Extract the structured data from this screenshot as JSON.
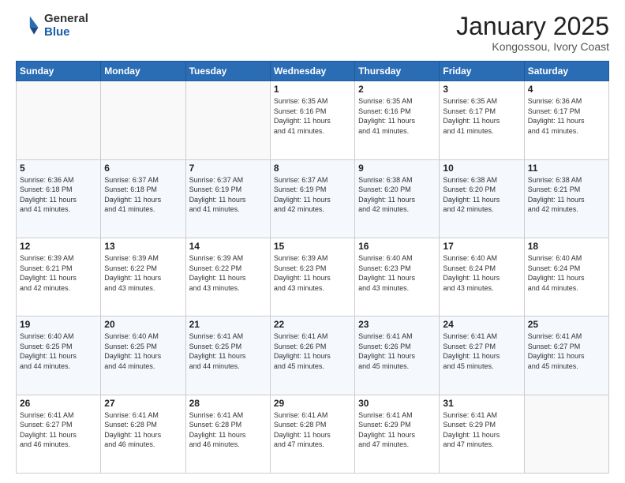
{
  "header": {
    "logo_general": "General",
    "logo_blue": "Blue",
    "title": "January 2025",
    "location": "Kongossou, Ivory Coast"
  },
  "weekdays": [
    "Sunday",
    "Monday",
    "Tuesday",
    "Wednesday",
    "Thursday",
    "Friday",
    "Saturday"
  ],
  "weeks": [
    [
      {
        "day": "",
        "info": ""
      },
      {
        "day": "",
        "info": ""
      },
      {
        "day": "",
        "info": ""
      },
      {
        "day": "1",
        "info": "Sunrise: 6:35 AM\nSunset: 6:16 PM\nDaylight: 11 hours\nand 41 minutes."
      },
      {
        "day": "2",
        "info": "Sunrise: 6:35 AM\nSunset: 6:16 PM\nDaylight: 11 hours\nand 41 minutes."
      },
      {
        "day": "3",
        "info": "Sunrise: 6:35 AM\nSunset: 6:17 PM\nDaylight: 11 hours\nand 41 minutes."
      },
      {
        "day": "4",
        "info": "Sunrise: 6:36 AM\nSunset: 6:17 PM\nDaylight: 11 hours\nand 41 minutes."
      }
    ],
    [
      {
        "day": "5",
        "info": "Sunrise: 6:36 AM\nSunset: 6:18 PM\nDaylight: 11 hours\nand 41 minutes."
      },
      {
        "day": "6",
        "info": "Sunrise: 6:37 AM\nSunset: 6:18 PM\nDaylight: 11 hours\nand 41 minutes."
      },
      {
        "day": "7",
        "info": "Sunrise: 6:37 AM\nSunset: 6:19 PM\nDaylight: 11 hours\nand 41 minutes."
      },
      {
        "day": "8",
        "info": "Sunrise: 6:37 AM\nSunset: 6:19 PM\nDaylight: 11 hours\nand 42 minutes."
      },
      {
        "day": "9",
        "info": "Sunrise: 6:38 AM\nSunset: 6:20 PM\nDaylight: 11 hours\nand 42 minutes."
      },
      {
        "day": "10",
        "info": "Sunrise: 6:38 AM\nSunset: 6:20 PM\nDaylight: 11 hours\nand 42 minutes."
      },
      {
        "day": "11",
        "info": "Sunrise: 6:38 AM\nSunset: 6:21 PM\nDaylight: 11 hours\nand 42 minutes."
      }
    ],
    [
      {
        "day": "12",
        "info": "Sunrise: 6:39 AM\nSunset: 6:21 PM\nDaylight: 11 hours\nand 42 minutes."
      },
      {
        "day": "13",
        "info": "Sunrise: 6:39 AM\nSunset: 6:22 PM\nDaylight: 11 hours\nand 43 minutes."
      },
      {
        "day": "14",
        "info": "Sunrise: 6:39 AM\nSunset: 6:22 PM\nDaylight: 11 hours\nand 43 minutes."
      },
      {
        "day": "15",
        "info": "Sunrise: 6:39 AM\nSunset: 6:23 PM\nDaylight: 11 hours\nand 43 minutes."
      },
      {
        "day": "16",
        "info": "Sunrise: 6:40 AM\nSunset: 6:23 PM\nDaylight: 11 hours\nand 43 minutes."
      },
      {
        "day": "17",
        "info": "Sunrise: 6:40 AM\nSunset: 6:24 PM\nDaylight: 11 hours\nand 43 minutes."
      },
      {
        "day": "18",
        "info": "Sunrise: 6:40 AM\nSunset: 6:24 PM\nDaylight: 11 hours\nand 44 minutes."
      }
    ],
    [
      {
        "day": "19",
        "info": "Sunrise: 6:40 AM\nSunset: 6:25 PM\nDaylight: 11 hours\nand 44 minutes."
      },
      {
        "day": "20",
        "info": "Sunrise: 6:40 AM\nSunset: 6:25 PM\nDaylight: 11 hours\nand 44 minutes."
      },
      {
        "day": "21",
        "info": "Sunrise: 6:41 AM\nSunset: 6:25 PM\nDaylight: 11 hours\nand 44 minutes."
      },
      {
        "day": "22",
        "info": "Sunrise: 6:41 AM\nSunset: 6:26 PM\nDaylight: 11 hours\nand 45 minutes."
      },
      {
        "day": "23",
        "info": "Sunrise: 6:41 AM\nSunset: 6:26 PM\nDaylight: 11 hours\nand 45 minutes."
      },
      {
        "day": "24",
        "info": "Sunrise: 6:41 AM\nSunset: 6:27 PM\nDaylight: 11 hours\nand 45 minutes."
      },
      {
        "day": "25",
        "info": "Sunrise: 6:41 AM\nSunset: 6:27 PM\nDaylight: 11 hours\nand 45 minutes."
      }
    ],
    [
      {
        "day": "26",
        "info": "Sunrise: 6:41 AM\nSunset: 6:27 PM\nDaylight: 11 hours\nand 46 minutes."
      },
      {
        "day": "27",
        "info": "Sunrise: 6:41 AM\nSunset: 6:28 PM\nDaylight: 11 hours\nand 46 minutes."
      },
      {
        "day": "28",
        "info": "Sunrise: 6:41 AM\nSunset: 6:28 PM\nDaylight: 11 hours\nand 46 minutes."
      },
      {
        "day": "29",
        "info": "Sunrise: 6:41 AM\nSunset: 6:28 PM\nDaylight: 11 hours\nand 47 minutes."
      },
      {
        "day": "30",
        "info": "Sunrise: 6:41 AM\nSunset: 6:29 PM\nDaylight: 11 hours\nand 47 minutes."
      },
      {
        "day": "31",
        "info": "Sunrise: 6:41 AM\nSunset: 6:29 PM\nDaylight: 11 hours\nand 47 minutes."
      },
      {
        "day": "",
        "info": ""
      }
    ]
  ]
}
